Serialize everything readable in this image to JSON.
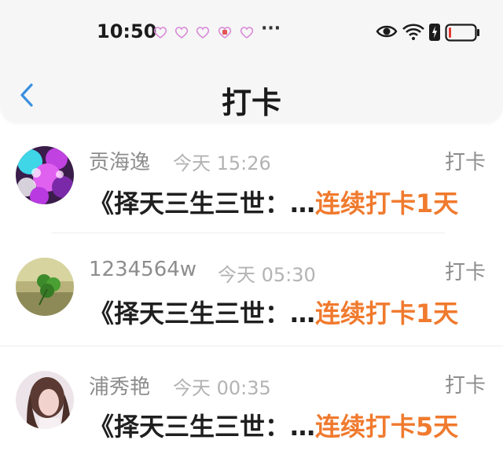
{
  "status": {
    "time": "10:50",
    "overflow": "···",
    "icons": [
      "heart-notification-icon",
      "heart-notification-icon",
      "heart-notification-icon",
      "app-notification-icon",
      "heart-notification-icon",
      "eye-icon",
      "wifi-icon",
      "battery-saver-icon",
      "battery-low-icon"
    ]
  },
  "header": {
    "title": "打卡",
    "back_icon": "chevron-left-icon"
  },
  "items": [
    {
      "name": "贡海逸",
      "time": "今天 15:26",
      "tag": "打卡",
      "text": "《择天三生三世：…",
      "streak": "连续打卡1天"
    },
    {
      "name": "1234564w",
      "time": "今天 05:30",
      "tag": "打卡",
      "text": "《择天三生三世：…",
      "streak": "连续打卡1天"
    },
    {
      "name": "浦秀艳",
      "time": "今天 00:35",
      "tag": "打卡",
      "text": "《择天三生三世：…",
      "streak": "连续打卡5天"
    }
  ],
  "colors": {
    "accent": "#f07a2e",
    "back": "#3a8fe0",
    "battery_low": "#e53935"
  }
}
